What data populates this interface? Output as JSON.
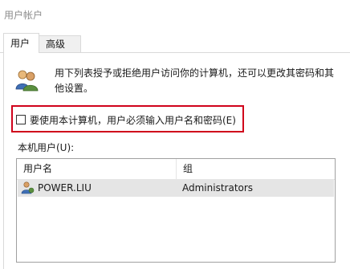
{
  "window": {
    "title": "用户帐户"
  },
  "tabs": [
    {
      "label": "用户",
      "active": true
    },
    {
      "label": "高级",
      "active": false
    }
  ],
  "description": "用下列表授予或拒绝用户访问你的计算机，还可以更改其密码和其他设置。",
  "require_password_checkbox": {
    "label": "要使用本计算机，用户必须输入用户名和密码(E)",
    "checked": false
  },
  "local_users": {
    "label": "本机用户(U):",
    "columns": [
      "用户名",
      "组"
    ],
    "rows": [
      {
        "username": "POWER.LIU",
        "group": "Administrators"
      }
    ]
  },
  "icons": {
    "users": "users-icon",
    "user_row": "user-icon"
  },
  "colors": {
    "highlight_border": "#d0021b",
    "selected_row": "#e5e5e5",
    "title_text": "#8c8c8c"
  }
}
